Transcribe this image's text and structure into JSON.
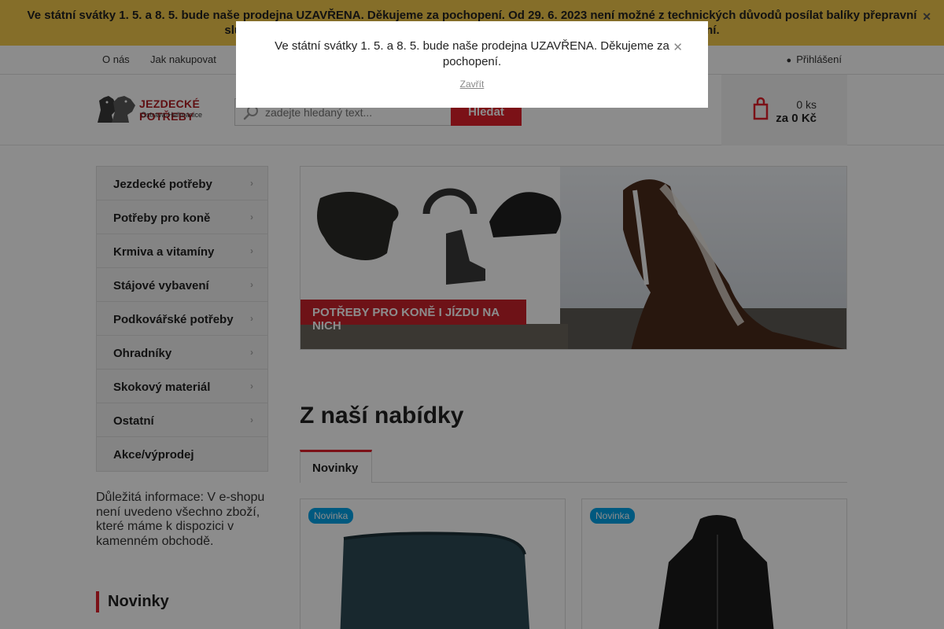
{
  "notice": {
    "text": "Ve státní svátky 1. 5. a 8. 5. bude naše prodejna UZAVŘENA. Děkujeme za pochopení. Od 29. 6. 2023 není možné z technických důvodů posílat balíky přepravní službou, je možný pouze osobní odběr přímo na naši prodejnu. Děkujeme za pochopení.",
    "close_icon": "close-icon"
  },
  "topnav": {
    "items": [
      "O nás",
      "Jak nakupovat"
    ],
    "login": "Přihlášení"
  },
  "header": {
    "logo_line1": "JEZDECKÉ POTŘEBY",
    "logo_line2": "Ostrava-Heřmanice",
    "search_placeholder": "zadejte hledaný text...",
    "search_button": "Hledat",
    "cart_count": "0 ks",
    "cart_total": "za 0 Kč"
  },
  "sidebar": {
    "categories": [
      "Jezdecké potřeby",
      "Potřeby pro koně",
      "Krmiva a vitamíny",
      "Stájové vybavení",
      "Podkovářské potřeby",
      "Ohradníky",
      "Skokový materiál",
      "Ostatní",
      "Akce/výprodej"
    ],
    "info": "Důležitá informace: V e-shopu není uvedeno všechno zboží, které máme k dispozici v kamenném obchodě.",
    "novinky_title": "Novinky"
  },
  "banner": {
    "caption": "POTŘEBY PRO KONĚ I JÍZDU NA NICH"
  },
  "main": {
    "section_title": "Z naší nabídky",
    "tab": "Novinky",
    "products": [
      {
        "badge": "Novinka"
      },
      {
        "badge": "Novinka"
      }
    ]
  },
  "modal": {
    "text": "Ve státní svátky 1. 5. a 8. 5. bude naše prodejna UZAVŘENA. Děkujeme za pochopení.",
    "close_link": "Zavřít"
  },
  "colors": {
    "accent": "#e0202a",
    "notice_bg": "#f2c94c",
    "badge": "#00a2e8"
  }
}
